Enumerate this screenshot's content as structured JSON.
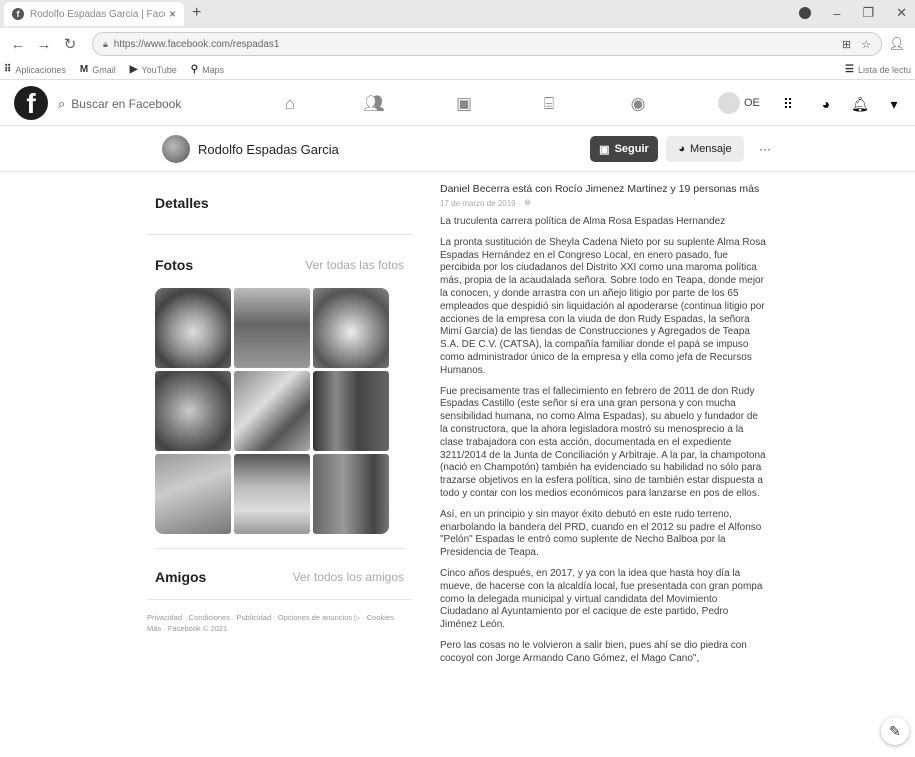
{
  "browser": {
    "tab_title": "Rodolfo Espadas Garcia | Facebo...",
    "tab_favicon": "f",
    "url": "https://www.facebook.com/respadas1",
    "bookmarks": [
      "Aplicaciones",
      "Gmail",
      "YouTube",
      "Maps"
    ],
    "reading_list": "Lista de lectu"
  },
  "fb": {
    "search_placeholder": "Buscar en Facebook",
    "user_short": "OE",
    "nav_icons": [
      "home-icon",
      "friends-icon",
      "watch-icon",
      "marketplace-icon",
      "groups-icon"
    ]
  },
  "profile": {
    "name": "Rodolfo Espadas Garcia",
    "follow_label": "Seguir",
    "message_label": "Mensaje",
    "more_label": "···"
  },
  "sidebar": {
    "details_title": "Detalles",
    "photos_title": "Fotos",
    "photos_link": "Ver todas las fotos",
    "friends_title": "Amigos",
    "friends_link": "Ver todos los amigos",
    "footer": "Privacidad · Condiciones · Publicidad · Opciones de anuncios ▷ · Cookies · Más · Facebook © 2021"
  },
  "post": {
    "author_line": "Daniel Becerra está con Rocío Jimenez Martinez y 19 personas más",
    "date": "17 de marzo de 2019 · ",
    "paragraphs": [
      "La truculenta carrera política de Alma Rosa Espadas Hernandez",
      "La pronta sustitución de Sheyla Cadena Nieto por su suplente Alma Rosa Espadas Hernández en el Congreso Local, en enero pasado, fue percibida por los ciudadanos del Distrito XXI como una maroma política más, propia de la acaudalada señora. Sobre todo en Teapa, donde mejor la conocen, y donde arrastra con un añejo litigio por parte de los 65 empleados que despidió sin liquidación al apoderarse (continua litigio por acciones de la empresa con la viuda de don Rudy Espadas, la señora Mimí García) de las tiendas de Construcciones y Agregados de Teapa S.A. DE C.V. (CATSA), la compañía familiar donde el papá se impuso como administrador único de la empresa y ella como jefa de Recursos Humanos.",
      "Fue precisamente tras el fallecimiento en febrero de 2011 de don Rudy Espadas Castillo (este señor sí era una gran persona y con mucha sensibilidad humana, no como Alma Espadas), su abuelo y fundador de la constructora, que la ahora legisladora mostró su menosprecio a la clase trabajadora con esta acción, documentada en el expediente 3211/2014 de la Junta de Conciliación y Arbitraje. A la par, la champotona (nació en Champotón) también ha evidenciado su habilidad no sólo para trazarse objetivos en la esfera política, sino de también estar dispuesta a todo y contar con los medios económicos para lanzarse en pos de ellos.",
      "Así, en un principio y sin mayor éxito debutó en este rudo terreno, enarbolando la bandera del PRD, cuando en el 2012 su padre el Alfonso \"Pelón\" Espadas le entró como suplente de Necho Balboa por la Presidencia de Teapa.",
      "Cinco años después, en 2017, y ya con la idea que hasta hoy día la mueve, de hacerse con la alcaldía local, fue presentada con gran pompa como la delegada municipal y virtual candidata del Movimiento Ciudadano  al Ayuntamiento por el cacique de este partido, Pedro Jiménez León.",
      "Pero las cosas no le volvieron a salir bien, pues ahí se dio piedra con cocoyol con Jorge Armando Cano Gómez, el Mago Cano\","
    ]
  }
}
